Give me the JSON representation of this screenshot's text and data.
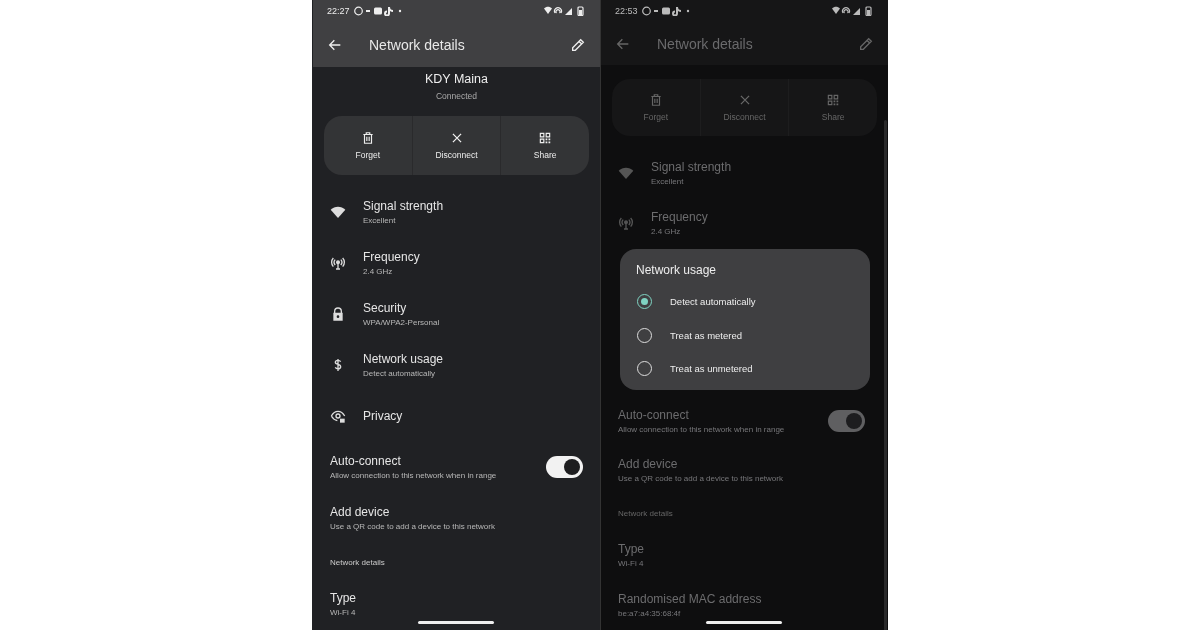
{
  "screens": [
    {
      "dimmed": false,
      "status_bar": {
        "time": "22:27"
      },
      "title": "Network details",
      "network": {
        "name": "KDY Maina",
        "status": "Connected"
      },
      "actions": [
        {
          "label": "Forget"
        },
        {
          "label": "Disconnect"
        },
        {
          "label": "Share"
        }
      ],
      "rows": [
        {
          "kind": "info",
          "title": "Signal strength",
          "subtitle": "Excellent"
        },
        {
          "kind": "info",
          "title": "Frequency",
          "subtitle": "2.4 GHz"
        },
        {
          "kind": "info",
          "title": "Security",
          "subtitle": "WPA/WPA2-Personal"
        },
        {
          "kind": "info",
          "title": "Network usage",
          "subtitle": "Detect automatically"
        },
        {
          "kind": "info",
          "title": "Privacy"
        },
        {
          "kind": "toggle",
          "title": "Auto-connect",
          "subtitle": "Allow connection to this network when in range",
          "on": true
        },
        {
          "kind": "plain",
          "title": "Add device",
          "subtitle": "Use a QR code to add a device to this network"
        },
        {
          "kind": "section",
          "title": "Network details"
        },
        {
          "kind": "plain",
          "title": "Type",
          "subtitle": "Wi-Fi 4"
        }
      ]
    },
    {
      "dimmed": true,
      "status_bar": {
        "time": "22:53"
      },
      "title": "Network details",
      "actions": [
        {
          "label": "Forget"
        },
        {
          "label": "Disconnect"
        },
        {
          "label": "Share"
        }
      ],
      "rows": [
        {
          "kind": "info",
          "title": "Signal strength",
          "subtitle": "Excellent"
        },
        {
          "kind": "info",
          "title": "Frequency",
          "subtitle": "2.4 GHz"
        },
        {
          "kind": "gap"
        },
        {
          "kind": "toggle",
          "title": "Auto-connect",
          "subtitle": "Allow connection to this network when in range",
          "on": true
        },
        {
          "kind": "plain",
          "title": "Add device",
          "subtitle": "Use a QR code to add a device to this network"
        },
        {
          "kind": "section",
          "title": "Network details"
        },
        {
          "kind": "plain",
          "title": "Type",
          "subtitle": "Wi-Fi 4"
        },
        {
          "kind": "plain",
          "title": "Randomised MAC address",
          "subtitle": "be:a7:a4:35:68:4f"
        }
      ],
      "dialog": {
        "title": "Network usage",
        "options": [
          {
            "label": "Detect automatically",
            "selected": true
          },
          {
            "label": "Treat as metered",
            "selected": false
          },
          {
            "label": "Treat as unmetered",
            "selected": false
          }
        ]
      }
    }
  ]
}
